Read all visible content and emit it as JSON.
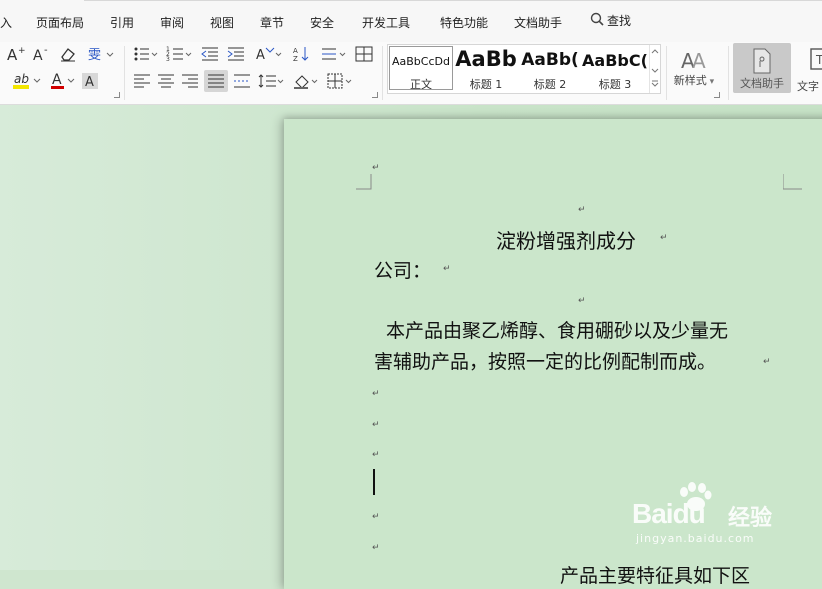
{
  "menubar": {
    "items": [
      "入",
      "页面布局",
      "引用",
      "审阅",
      "视图",
      "章节",
      "安全",
      "开发工具",
      "特色功能",
      "文档助手"
    ],
    "search_label": "查找"
  },
  "styles": {
    "cards": [
      {
        "sample": "AaBbCcDd",
        "label": "正文"
      },
      {
        "sample": "AaBb",
        "label": "标题 1"
      },
      {
        "sample": "AaBb(",
        "label": "标题 2"
      },
      {
        "sample": "AaBbC(",
        "label": "标题 3"
      }
    ],
    "new_style_label": "新样式",
    "doc_helper_label": "文档助手",
    "text_tool_label": "文字"
  },
  "document": {
    "title": "淀粉增强剂成分",
    "company": "公司：",
    "body_line1": "本产品由聚乙烯醇、食用硼砂以及少量无",
    "body_line2": "害辅助产品，按照一定的比例配制而成。",
    "partial_bottom": "产品主要特征具如下区",
    "para_mark": "↵"
  },
  "watermark": {
    "brand": "Baidu",
    "brand_cn": "经验",
    "url": "jingyan.baidu.com"
  }
}
